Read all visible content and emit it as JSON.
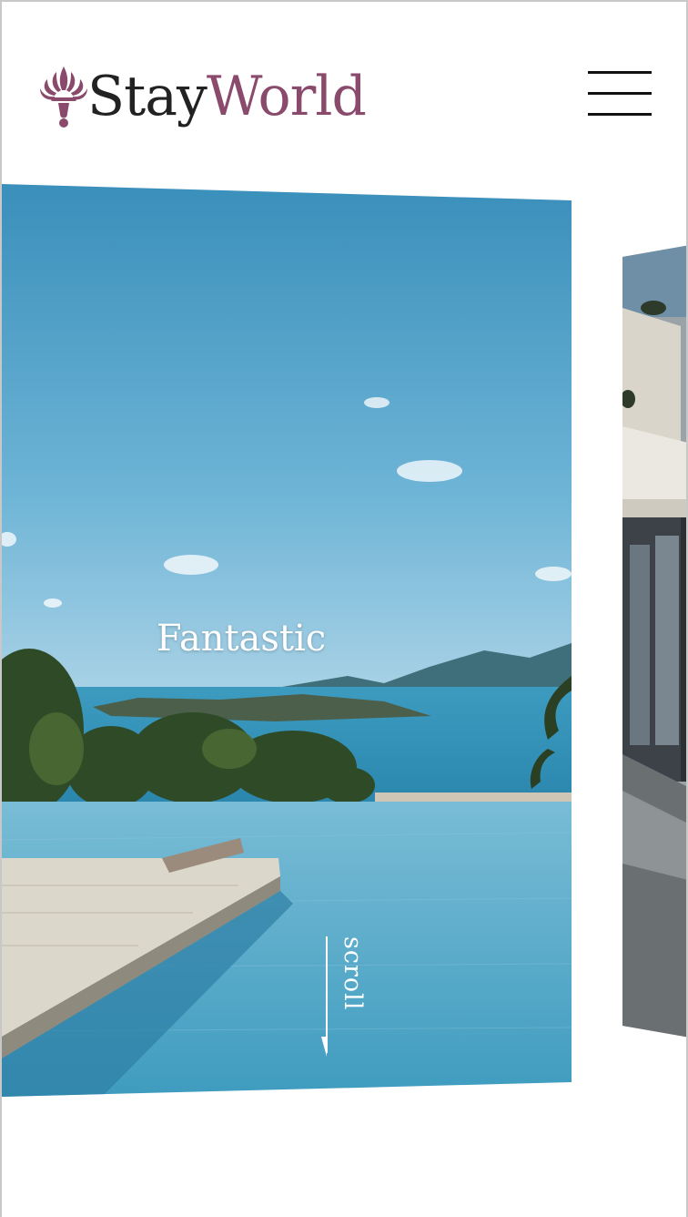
{
  "header": {
    "logo_part1": "Stay",
    "logo_part2": "World",
    "logo_icon": "fleur-ornament-icon",
    "menu_icon": "hamburger-menu-icon"
  },
  "hero": {
    "caption": "Fantastic",
    "scroll_label": "scroll"
  },
  "colors": {
    "brand": "#8a4a6c",
    "text_dark": "#222222",
    "sky": "#3a90bc",
    "sea": "#2f8fb3",
    "pool": "#57a8c6"
  }
}
